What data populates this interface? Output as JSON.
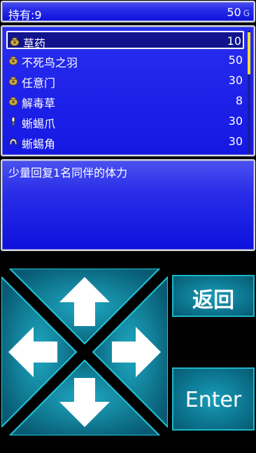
{
  "status": {
    "held_label": "持有:9",
    "gold_value": "50",
    "gold_unit": "G"
  },
  "items": [
    {
      "name": "草药",
      "qty": "10",
      "icon": "bag-icon",
      "selected": true
    },
    {
      "name": "不死鸟之羽",
      "qty": "50",
      "icon": "bag-icon",
      "selected": false
    },
    {
      "name": "任意门",
      "qty": "30",
      "icon": "bag-icon",
      "selected": false
    },
    {
      "name": "解毒草",
      "qty": "8",
      "icon": "bag-icon",
      "selected": false
    },
    {
      "name": "蜥蜴爪",
      "qty": "30",
      "icon": "claw-icon",
      "selected": false
    },
    {
      "name": "蜥蜴角",
      "qty": "30",
      "icon": "horn-icon",
      "selected": false
    }
  ],
  "description": "少量回复1名同伴的体力",
  "buttons": {
    "back_label": "返回",
    "enter_label": "Enter"
  },
  "colors": {
    "window_top": "#4a52f0",
    "window_bottom": "#0d10dc",
    "scroll_thumb": "#f5e020",
    "button_cyan": "#1a9cb8"
  }
}
